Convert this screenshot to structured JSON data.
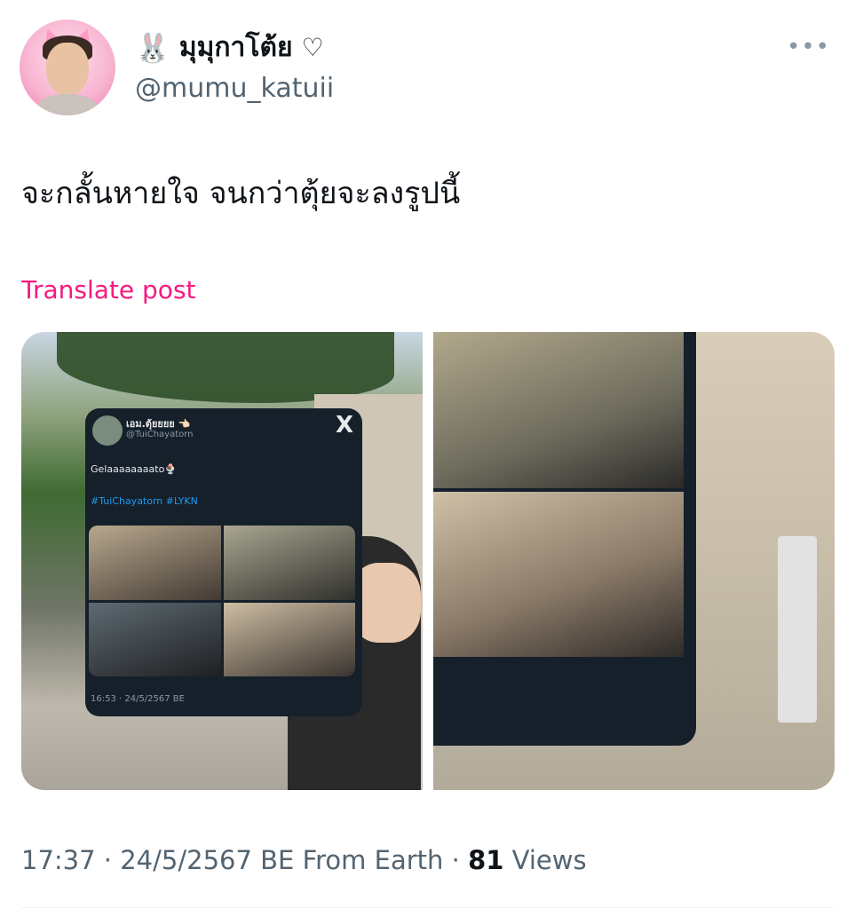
{
  "author": {
    "emoji": "🐰",
    "display_name": "มุมุกาโต้ย",
    "heart": "♡",
    "handle": "@mumu_katuii"
  },
  "more_icon": "•••",
  "post": {
    "text": "จะกลั้นหายใจ จนกว่าตุ้ยจะลงรูปนี้",
    "translate_label": "Translate post"
  },
  "embedded_post": {
    "display_name": "เอม.ตุ้ยยยย 👈🏻",
    "handle": "@TuiChayatorn",
    "close_icon": "X",
    "text": "Gelaaaaaaaato🍨",
    "hashtags": "#TuiChayatorn #LYKN",
    "timestamp": "16:53 · 24/5/2567 BE"
  },
  "meta": {
    "time_date": "17:37 · 24/5/2567 BE From Earth · ",
    "views_count": "81",
    "views_label": " Views"
  },
  "colors": {
    "accent_pink": "#f91880",
    "link_blue": "#1d9bf0",
    "dark_card": "#15202b"
  }
}
